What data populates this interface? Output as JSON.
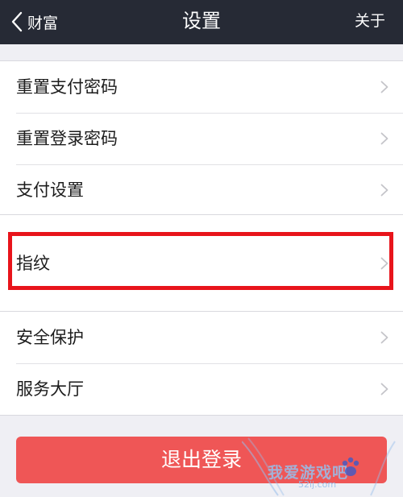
{
  "header": {
    "back_label": "财富",
    "title": "设置",
    "about_label": "关于"
  },
  "groups": [
    {
      "items": [
        {
          "label": "重置支付密码"
        },
        {
          "label": "重置登录密码"
        },
        {
          "label": "支付设置"
        }
      ]
    },
    {
      "items": [
        {
          "label": "指纹"
        }
      ]
    },
    {
      "items": [
        {
          "label": "安全保护"
        },
        {
          "label": "服务大厅"
        }
      ]
    }
  ],
  "logout_label": "退出登录",
  "watermark": {
    "text": "我爱游戏吧",
    "sub": "52ij.com"
  },
  "colors": {
    "nav_bg": "#262a35",
    "page_bg": "#efeff4",
    "logout_bg": "#ef5656",
    "highlight_border": "#e8141b"
  }
}
